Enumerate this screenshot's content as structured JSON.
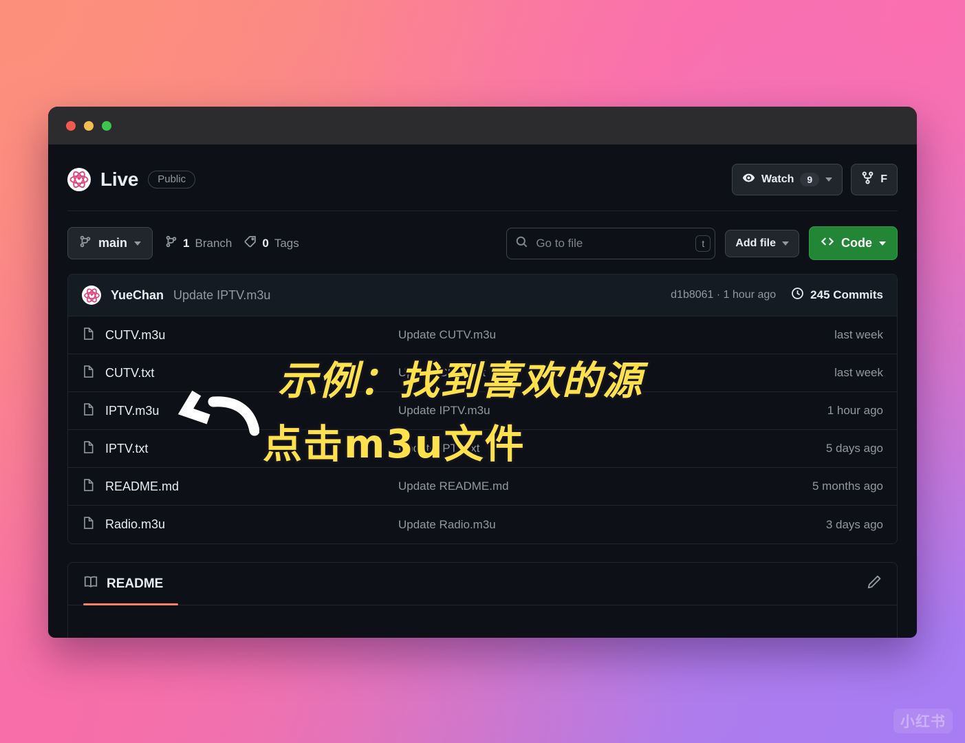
{
  "window": {
    "traffic_lights": [
      "close",
      "minimize",
      "maximize"
    ]
  },
  "repo": {
    "name": "Live",
    "visibility": "Public",
    "avatar_icon": "atom-avatar-icon",
    "watch_label": "Watch",
    "watch_count": "9",
    "watch_icon": "eye-icon",
    "fork_label": "F",
    "fork_icon": "fork-icon"
  },
  "toolbar": {
    "branch_name": "main",
    "branch_icon": "branch-icon",
    "branch_count": "1",
    "branch_word": "Branch",
    "tag_count": "0",
    "tag_word": "Tags",
    "tag_icon": "tag-icon",
    "search_placeholder": "Go to file",
    "search_value": "",
    "search_icon": "search-icon",
    "search_kbd": "t",
    "add_file_label": "Add file",
    "code_label": "Code",
    "code_icon": "code-brackets-icon",
    "code_color": "#238636"
  },
  "commit_bar": {
    "author": "YueChan",
    "message": "Update IPTV.m3u",
    "hash_and_time": "d1b8061 · 1 hour ago",
    "commits_label": "245 Commits",
    "history_icon": "history-clock-icon",
    "avatar_icon": "atom-avatar-icon"
  },
  "files": [
    {
      "icon": "file-icon",
      "name": "CUTV.m3u",
      "message": "Update CUTV.m3u",
      "time": "last week"
    },
    {
      "icon": "file-icon",
      "name": "CUTV.txt",
      "message": "Update CUTV.txt",
      "time": "last week"
    },
    {
      "icon": "file-icon",
      "name": "IPTV.m3u",
      "message": "Update IPTV.m3u",
      "time": "1 hour ago"
    },
    {
      "icon": "file-icon",
      "name": "IPTV.txt",
      "message": "Update IPTV.txt",
      "time": "5 days ago"
    },
    {
      "icon": "file-icon",
      "name": "README.md",
      "message": "Update README.md",
      "time": "5 months ago"
    },
    {
      "icon": "file-icon",
      "name": "Radio.m3u",
      "message": "Update Radio.m3u",
      "time": "3 days ago"
    }
  ],
  "readme": {
    "tab_label": "README",
    "book_icon": "book-icon",
    "edit_icon": "pencil-icon",
    "accent_color": "#f78166"
  },
  "annotations": {
    "line1": "示例：找到喜欢的源",
    "line2": "点击m3u文件",
    "text_color": "#ffe14d",
    "arrow_icon": "curved-arrow-left-icon"
  },
  "watermark": {
    "label": "小红书"
  }
}
